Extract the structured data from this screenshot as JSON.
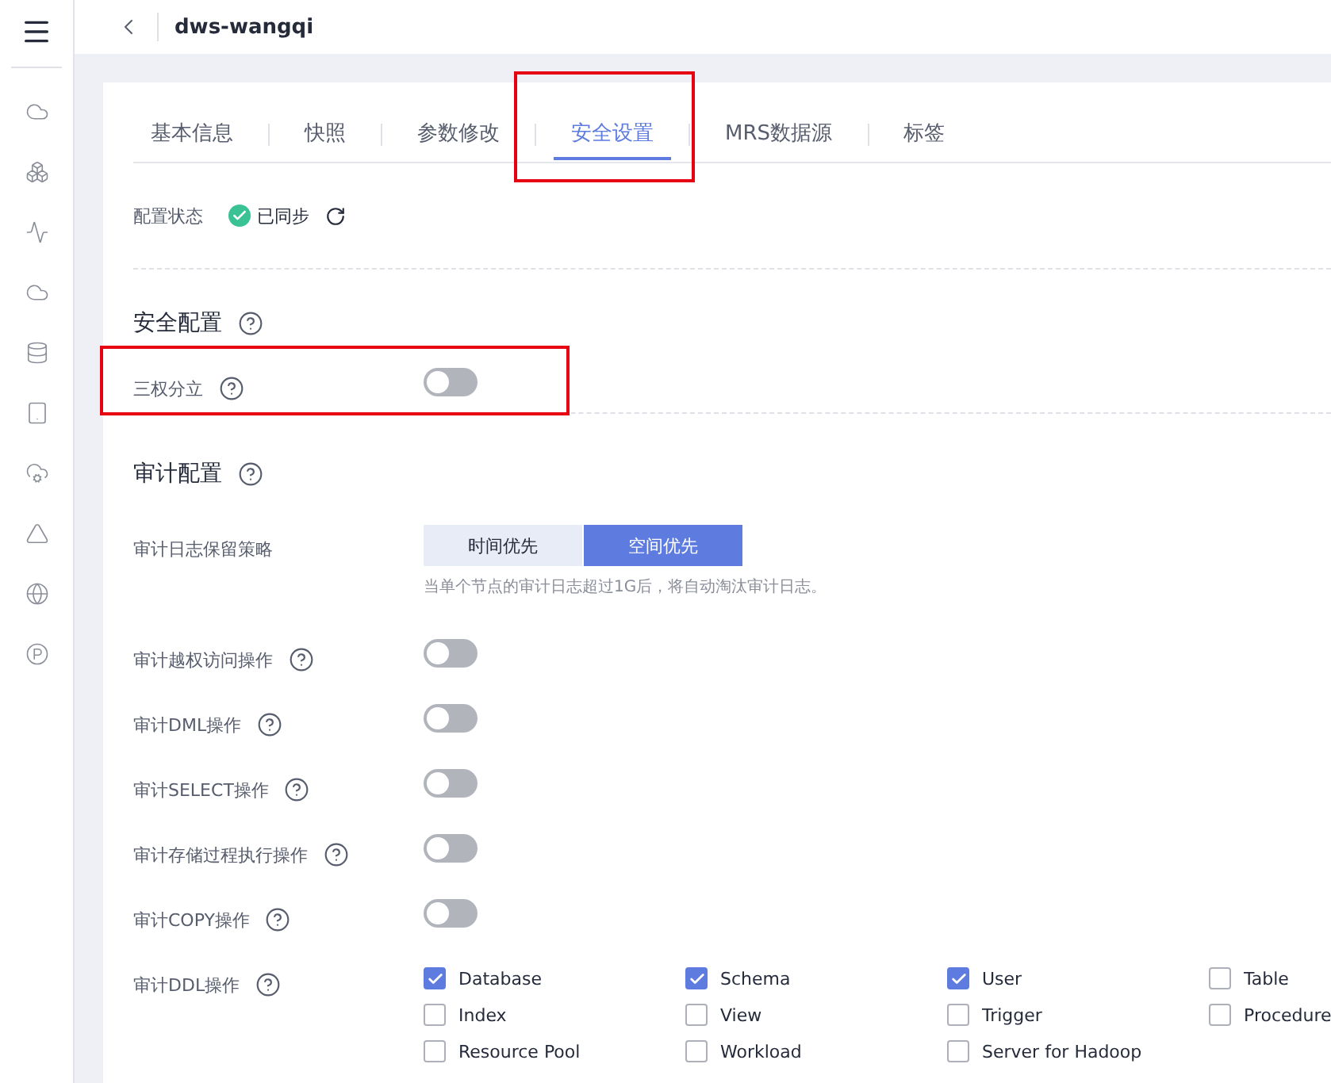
{
  "header": {
    "title": "dws-wangqi"
  },
  "tabs": [
    {
      "label": "基本信息",
      "selected": false,
      "highlighted": false
    },
    {
      "label": "快照",
      "selected": false,
      "highlighted": false
    },
    {
      "label": "参数修改",
      "selected": false,
      "highlighted": false
    },
    {
      "label": "安全设置",
      "selected": true,
      "highlighted": true
    },
    {
      "label": "MRS数据源",
      "selected": false,
      "highlighted": false
    },
    {
      "label": "标签",
      "selected": false,
      "highlighted": false
    }
  ],
  "config_status": {
    "label": "配置状态",
    "value": "已同步",
    "synced": true
  },
  "security": {
    "title": "安全配置",
    "settings": [
      {
        "label": "三权分立",
        "on": false,
        "highlighted": true
      }
    ]
  },
  "audit": {
    "title": "审计配置",
    "retention": {
      "label": "审计日志保留策略",
      "options": [
        {
          "label": "时间优先",
          "selected": false
        },
        {
          "label": "空间优先",
          "selected": true
        }
      ],
      "hint": "当单个节点的审计日志超过1G后，将自动淘汰审计日志。"
    },
    "settings": [
      {
        "label": "审计越权访问操作",
        "on": false
      },
      {
        "label": "审计DML操作",
        "on": false
      },
      {
        "label": "审计SELECT操作",
        "on": false
      },
      {
        "label": "审计存储过程执行操作",
        "on": false
      },
      {
        "label": "审计COPY操作",
        "on": false
      }
    ],
    "ddl": {
      "label": "审计DDL操作",
      "options": [
        {
          "label": "Database",
          "checked": true
        },
        {
          "label": "Schema",
          "checked": true
        },
        {
          "label": "User",
          "checked": true
        },
        {
          "label": "Table",
          "checked": false
        },
        {
          "label": "Index",
          "checked": false
        },
        {
          "label": "View",
          "checked": false
        },
        {
          "label": "Trigger",
          "checked": false
        },
        {
          "label": "Procedure",
          "checked": false
        },
        {
          "label": "Resource Pool",
          "checked": false
        },
        {
          "label": "Workload",
          "checked": false
        },
        {
          "label": "Server for Hadoop",
          "checked": false
        }
      ]
    }
  }
}
